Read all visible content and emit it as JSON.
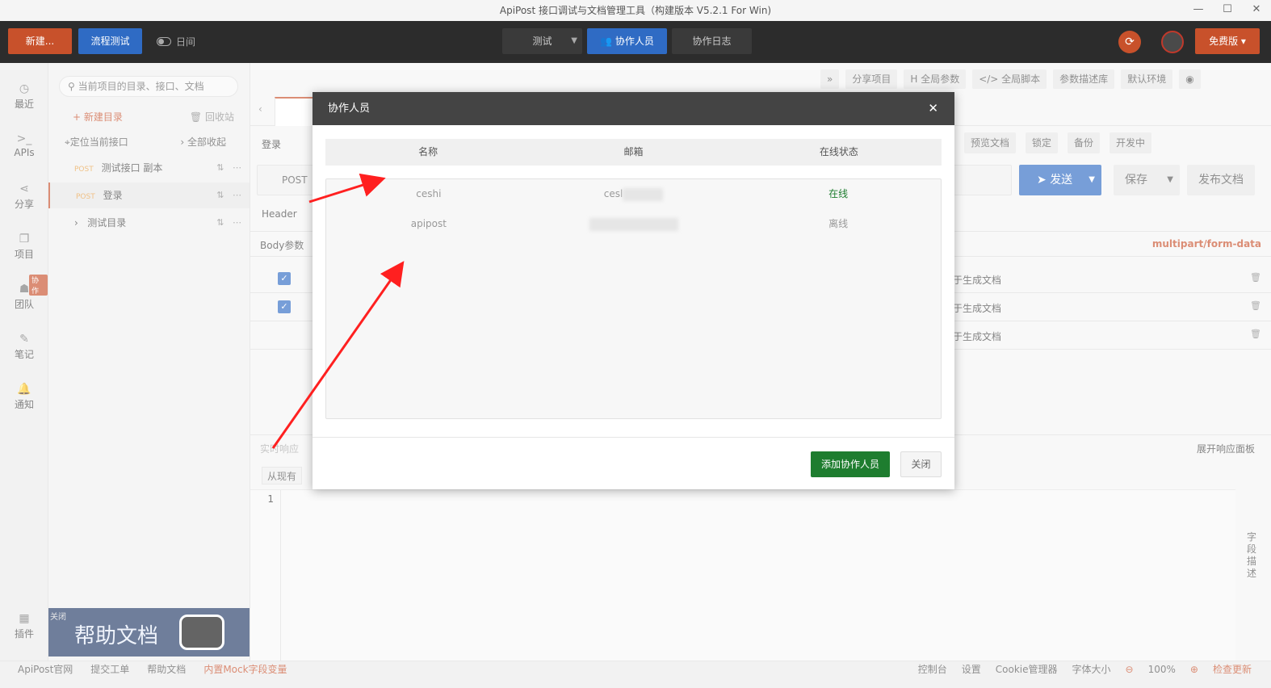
{
  "window": {
    "title": "ApiPost 接口调试与文档管理工具（构建版本 V5.2.1 For Win)",
    "minimize": "—",
    "maximize": "☐",
    "close": "✕"
  },
  "topbar": {
    "new_label": "新建...",
    "flow_label": "流程测试",
    "log_label": "日间",
    "tabs": {
      "test": "测试",
      "collab": "协作人员",
      "log": "协作日志"
    },
    "plan_label": "免费版"
  },
  "leftnav": {
    "items": [
      {
        "label": "最近",
        "icon": "clock-icon"
      },
      {
        "label": "APIs",
        "icon": "terminal-icon"
      },
      {
        "label": "分享",
        "icon": "share-icon"
      },
      {
        "label": "项目",
        "icon": "project-icon"
      },
      {
        "label": "团队",
        "icon": "team-icon"
      },
      {
        "label": "笔记",
        "icon": "note-icon"
      },
      {
        "label": "通知",
        "icon": "bell-icon"
      },
      {
        "label": "插件",
        "icon": "plugin-icon"
      }
    ],
    "team_badge": "协作"
  },
  "tree": {
    "search_placeholder": "当前项目的目录、接口、文档",
    "new_dir": "+ 新建目录",
    "recycle": "回收站",
    "locate": "定位当前接口",
    "collapse": "全部收起",
    "rows": [
      {
        "method": "POST",
        "name": "测试接口 副本"
      },
      {
        "method": "POST",
        "name": "登录"
      },
      {
        "method": "",
        "name": "测试目录"
      }
    ],
    "help": {
      "close": "关闭",
      "title": "帮助文档"
    }
  },
  "main": {
    "toolbar": [
      "»",
      "分享项目",
      "H 全局参数",
      "</> 全局脚本",
      "参数描述库",
      "默认环境",
      "◉"
    ],
    "crumb": "登录",
    "ops": [
      "预览文档",
      "锁定",
      "备份",
      "开发中"
    ],
    "method": "POST",
    "send": "发送",
    "save": "保存",
    "publish": "发布文档",
    "header_label": "Header",
    "body_label": "Body参数",
    "content_type": "multipart/form-data",
    "param_desc": "于生成文档",
    "resp_label": "实时响应",
    "expand_resp": "展开响应面板",
    "copy_btn": "从现有",
    "line_no": "1",
    "field_desc": "字段描述"
  },
  "modal": {
    "title": "协作人员",
    "columns": [
      "名称",
      "邮箱",
      "在线状态"
    ],
    "rows": [
      {
        "name": "ceshi",
        "email": "cesl",
        "status": "在线"
      },
      {
        "name": "apipost",
        "email": "",
        "status": "离线"
      }
    ],
    "add_label": "添加协作人员",
    "close_label": "关闭"
  },
  "statusbar": {
    "left": [
      "ApiPost官网",
      "提交工单",
      "帮助文档",
      "内置Mock字段变量"
    ],
    "right": [
      "控制台",
      "设置",
      "Cookie管理器",
      "字体大小",
      "100%",
      "检查更新"
    ]
  },
  "colors": {
    "accent": "#c8512b",
    "primary": "#2f6bc4",
    "success": "#1e7d2f",
    "annotation": "#ff2020"
  }
}
